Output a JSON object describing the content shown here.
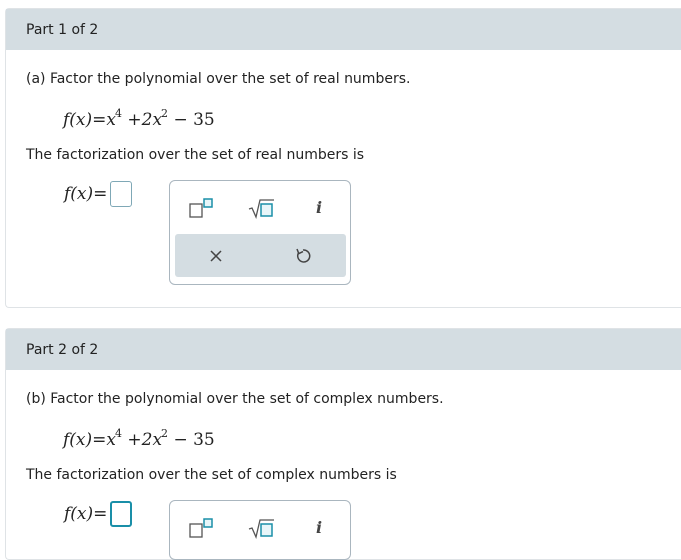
{
  "part1": {
    "header": "Part 1 of 2",
    "question": "(a) Factor the polynomial over the set of real numbers.",
    "function_lhs": "f(x)=",
    "function_expr": {
      "t1": "x",
      "e1": "4",
      "op1": " +",
      "t2": "2x",
      "e2": "2",
      "t3": " − 35"
    },
    "instruction": "The factorization over the set of real numbers is",
    "answer_label": "f(x)=",
    "answer_value": ""
  },
  "part2": {
    "header": "Part 2 of 2",
    "question": "(b) Factor the polynomial over the set of complex numbers.",
    "function_lhs": "f(x)=",
    "function_expr": {
      "t1": "x",
      "e1": "4",
      "op1": " +",
      "t2": "2x",
      "e2": "2",
      "t3": " − 35"
    },
    "instruction": "The factorization over the set of complex numbers is",
    "answer_label": "f(x)=",
    "answer_value": ""
  },
  "palette": {
    "tools": [
      "exponent-template-icon",
      "square-root-template-icon",
      "imaginary-unit-i"
    ],
    "imaginary_glyph": "i",
    "actions": [
      "clear-icon",
      "undo-icon"
    ]
  },
  "colors": {
    "header_bg": "#d4dde2",
    "accent": "#1a8fa8",
    "border": "#dfe3e6"
  }
}
